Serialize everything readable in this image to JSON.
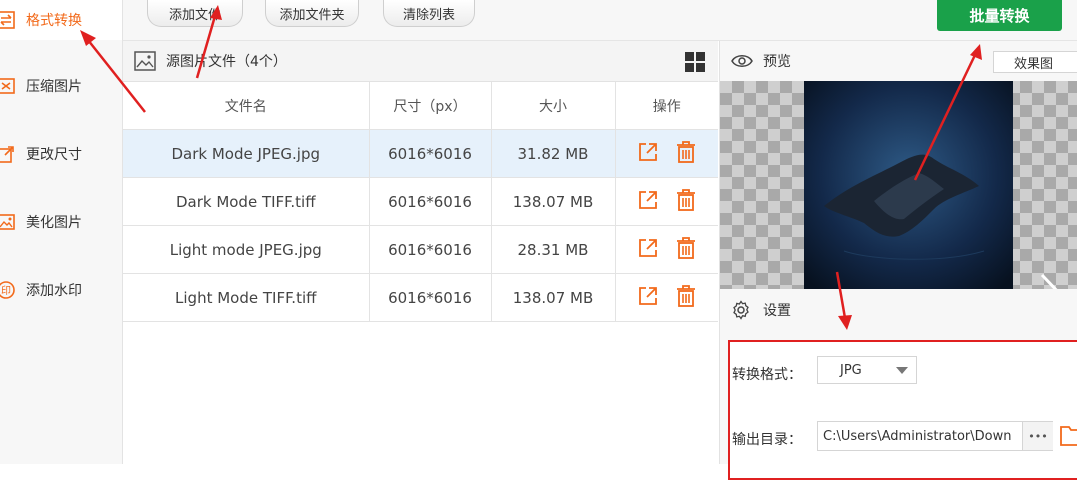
{
  "sidebar": {
    "items": [
      {
        "label": "格式转换",
        "icon": "format-convert-icon",
        "active": true
      },
      {
        "label": "压缩图片",
        "icon": "compress-icon",
        "active": false
      },
      {
        "label": "更改尺寸",
        "icon": "resize-icon",
        "active": false
      },
      {
        "label": "美化图片",
        "icon": "beautify-icon",
        "active": false
      },
      {
        "label": "添加水印",
        "icon": "watermark-icon",
        "active": false
      }
    ]
  },
  "toolbar": {
    "add_file": "添加文件",
    "add_folder": "添加文件夹",
    "clear_list": "清除列表",
    "batch_convert": "批量转换"
  },
  "file_panel": {
    "title": "源图片文件（4个）",
    "columns": [
      "文件名",
      "尺寸（px）",
      "大小",
      "操作"
    ],
    "rows": [
      {
        "name": "Dark Mode JPEG.jpg",
        "size": "6016*6016",
        "filesize": "31.82 MB"
      },
      {
        "name": "Dark Mode TIFF.tiff",
        "size": "6016*6016",
        "filesize": "138.07 MB"
      },
      {
        "name": "Light mode JPEG.jpg",
        "size": "6016*6016",
        "filesize": "28.31 MB"
      },
      {
        "name": "Light Mode TIFF.tiff",
        "size": "6016*6016",
        "filesize": "138.07 MB"
      }
    ]
  },
  "preview": {
    "title": "预览",
    "mode_select": "效果图"
  },
  "settings": {
    "title": "设置",
    "format_label": "转换格式：",
    "format_value": "JPG",
    "output_label": "输出目录：",
    "output_value": "C:\\Users\\Administrator\\Down",
    "more_label": "•••"
  },
  "colors": {
    "accent": "#f26a1b",
    "batch_button": "#1aa14a",
    "annotation": "#e02020",
    "selected_row": "#e6f1fb"
  }
}
